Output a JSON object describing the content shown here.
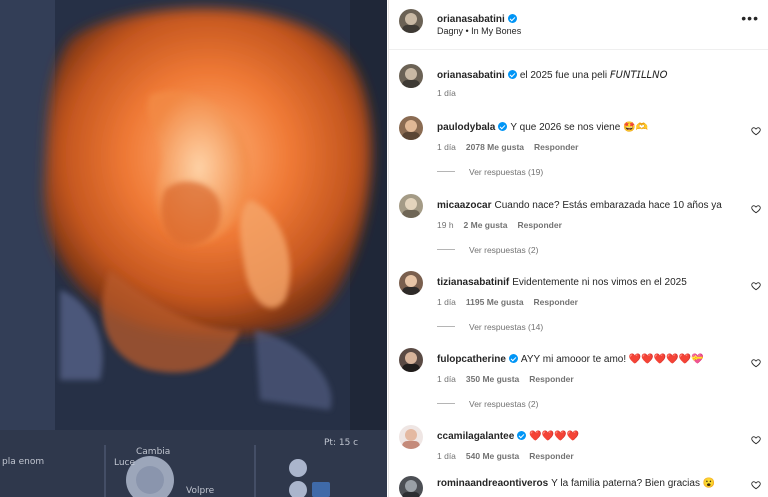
{
  "media": {
    "scan_labels": [
      "Cambia",
      "Luce",
      "Volpre",
      "pla enom",
      "Pt: 15 c"
    ]
  },
  "header": {
    "username": "orianasabatini",
    "music": "Dagny • In My Bones",
    "more_icon": "more-horizontal-icon"
  },
  "caption": {
    "username": "orianasabatini",
    "text": "el 2025 fue una peli 𝘍𝘜𝘕𝘛𝘐𝘓𝘓𝘕𝘖",
    "time": "1 día"
  },
  "comments": [
    {
      "username": "paulodybala",
      "verified": true,
      "text": "Y que 2026 se nos viene 🤩🫶",
      "time": "1 día",
      "likes": "2078 Me gusta",
      "reply": "Responder",
      "replies": "Ver respuestas (19)"
    },
    {
      "username": "micaazocar",
      "verified": false,
      "text": "Cuando nace? Estás embarazada hace 10 años ya",
      "time": "19 h",
      "likes": "2 Me gusta",
      "reply": "Responder",
      "replies": "Ver respuestas (2)"
    },
    {
      "username": "tizianasabatinif",
      "verified": false,
      "text": "Evidentemente ni nos vimos en el 2025",
      "time": "1 día",
      "likes": "1195 Me gusta",
      "reply": "Responder",
      "replies": "Ver respuestas (14)"
    },
    {
      "username": "fulopcatherine",
      "verified": true,
      "text": "AYY mi amooor te amo! ❤️❤️❤️❤️❤️💝",
      "time": "1 día",
      "likes": "350 Me gusta",
      "reply": "Responder",
      "replies": "Ver respuestas (2)"
    },
    {
      "username": "ccamilagalantee",
      "verified": true,
      "text": "❤️❤️❤️❤️",
      "time": "1 día",
      "likes": "540 Me gusta",
      "reply": "Responder",
      "replies": ""
    },
    {
      "username": "rominaandreaontiveros",
      "verified": false,
      "text": "Y la familia paterna? Bien gracias 😮",
      "time": "",
      "likes": "",
      "reply": "",
      "replies": ""
    }
  ],
  "colors": {
    "verified": "#0095f6",
    "meta": "#737373",
    "text": "#262626"
  }
}
